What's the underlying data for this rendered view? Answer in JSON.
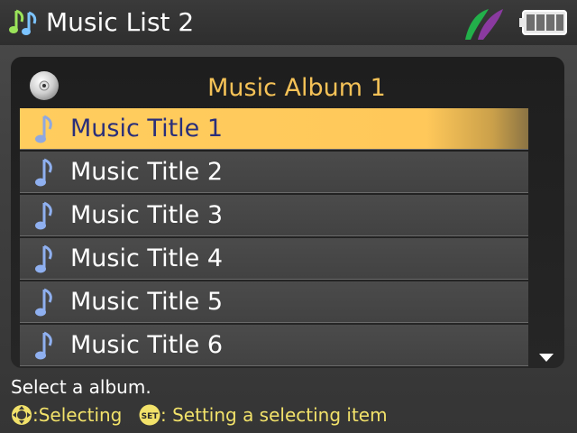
{
  "header": {
    "title": "Music List 2",
    "note_icon": "music-note-icon",
    "battery_icon": "battery-icon",
    "status_icon": "leaf-icon"
  },
  "album": {
    "name": "Music Album 1",
    "icon": "cd-icon"
  },
  "tracks": [
    {
      "label": "Music Title 1",
      "selected": true
    },
    {
      "label": "Music Title 2",
      "selected": false
    },
    {
      "label": "Music Title 3",
      "selected": false
    },
    {
      "label": "Music Title 4",
      "selected": false
    },
    {
      "label": "Music Title 5",
      "selected": false
    },
    {
      "label": "Music Title 6",
      "selected": false
    }
  ],
  "footer": {
    "message": "Select a album.",
    "help_select": ":Selecting",
    "help_set": ": Setting a selecting item",
    "set_icon_text": "SET"
  },
  "colors": {
    "accent": "#ffc85a",
    "album_text": "#f5c257",
    "help_text": "#f2e26a",
    "selected_text": "#2a2f7a"
  }
}
